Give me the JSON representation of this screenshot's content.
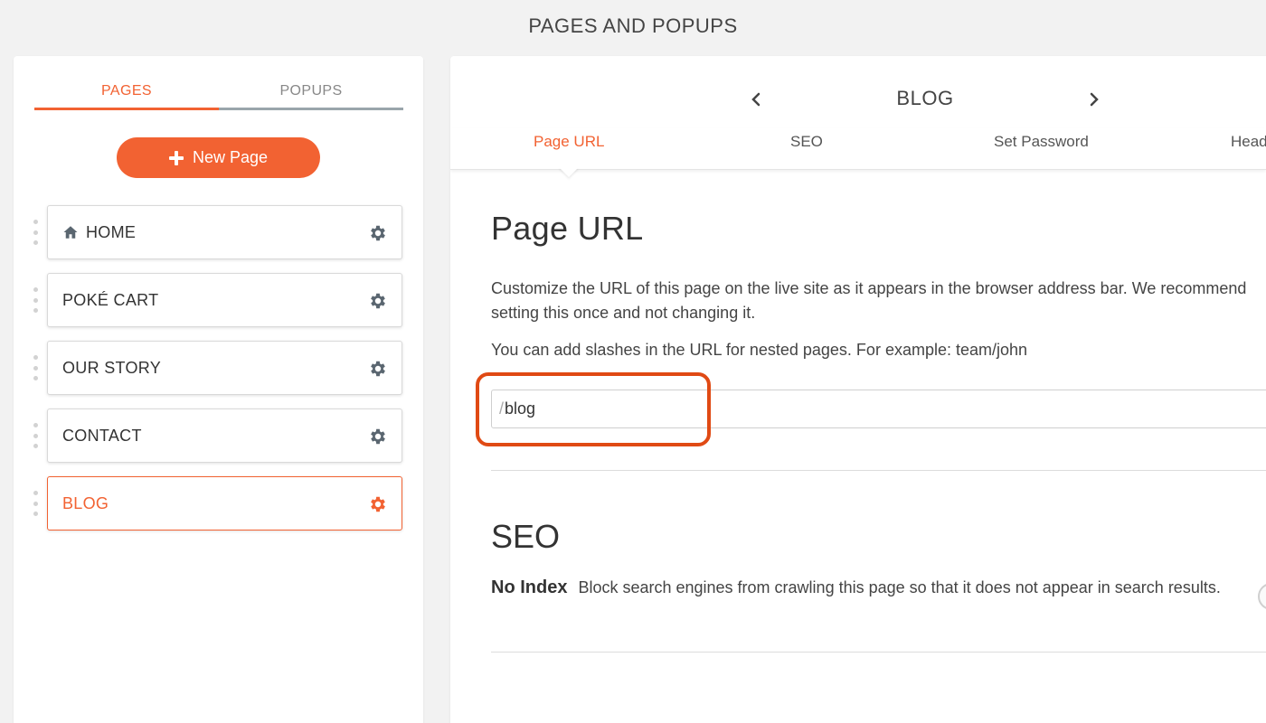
{
  "header": {
    "title": "PAGES AND POPUPS"
  },
  "sidebar": {
    "tabs": [
      {
        "label": "PAGES",
        "active": true
      },
      {
        "label": "POPUPS",
        "active": false
      }
    ],
    "new_page_label": "New Page",
    "pages": [
      {
        "label": "HOME",
        "icon": "home-icon"
      },
      {
        "label": "POKÉ CART"
      },
      {
        "label": "OUR STORY"
      },
      {
        "label": "CONTACT"
      },
      {
        "label": "BLOG",
        "active": true
      }
    ]
  },
  "editor": {
    "current_page": "BLOG",
    "tabs": [
      {
        "label": "Page URL",
        "active": true
      },
      {
        "label": "SEO"
      },
      {
        "label": "Set Password"
      },
      {
        "label": "Headers"
      }
    ],
    "page_url": {
      "heading": "Page URL",
      "description": "Customize the URL of this page on the live site as it appears in the browser address bar. We recommend",
      "description_2": "setting this once and not changing it.",
      "hint": "You can add slashes in the URL for nested pages. For example: team/john",
      "prefix": "/",
      "value": "blog"
    },
    "seo": {
      "heading": "SEO",
      "noindex_label": "No Index",
      "noindex_desc": "Block search engines from crawling this page so that it does not appear in search results."
    }
  },
  "colors": {
    "accent": "#f26232",
    "highlight": "#e04a14"
  }
}
